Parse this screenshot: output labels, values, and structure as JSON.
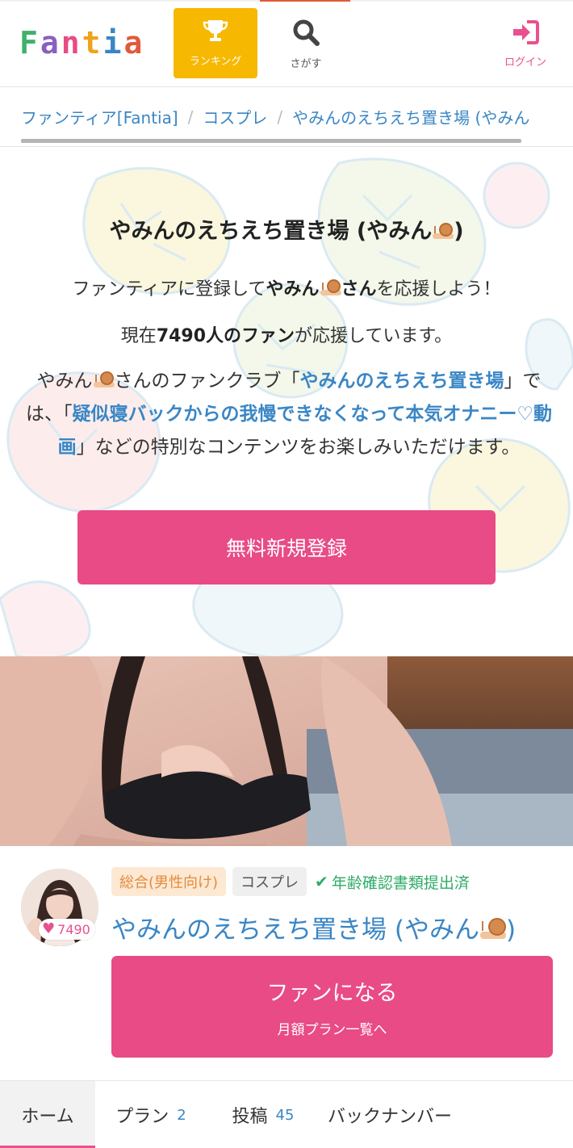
{
  "header": {
    "logo_letters": [
      {
        "char": "F",
        "color": "#3fb16a"
      },
      {
        "char": "a",
        "color": "#8a5fc0"
      },
      {
        "char": "n",
        "color": "#e84b85"
      },
      {
        "char": "t",
        "color": "#f0a21c"
      },
      {
        "char": "i",
        "color": "#3a86c5"
      },
      {
        "char": "a",
        "color": "#e05a3c"
      }
    ],
    "ranking_label": "ランキング",
    "search_label": "さがす",
    "login_label": "ログイン"
  },
  "breadcrumb": {
    "items": [
      "ファンティア[Fantia]",
      "コスプレ",
      "やみんのえちえち置き場 (やみん"
    ],
    "separator": "/"
  },
  "intro": {
    "title_text": "やみんのえちえち置き場 (やみん",
    "title_close": ")",
    "line1_pre": "ファンティアに登録して",
    "line1_name": "やみん",
    "line1_san": "さん",
    "line1_post": "を応援しよう！",
    "line2_pre": "現在",
    "line2_count": "7490人のファン",
    "line2_post": "が応援しています。",
    "desc_pre": "やみん",
    "desc_mid": "さんのファンクラブ「",
    "desc_club": "やみんのえちえち置き場",
    "desc_mid2": "」では、「",
    "desc_post_title": "疑似寝バックからの我慢できなくなって本気オナニー♡動画",
    "desc_tail": "」などの特別なコンテンツをお楽しみいただけます。",
    "register_button": "無料新規登録"
  },
  "profile": {
    "fan_count": "7490",
    "tags": {
      "general": "総合(男性向け)",
      "category": "コスプレ",
      "verified": "年齢確認書類提出済"
    },
    "name": "やみんのえちえち置き場 (やみん",
    "name_close": ")",
    "fan_button_main": "ファンになる",
    "fan_button_sub": "月額プラン一覧へ"
  },
  "tabs": {
    "home": "ホーム",
    "plan": "プラン",
    "plan_count": "2",
    "posts": "投稿",
    "posts_count": "45",
    "back_number": "バックナンバー"
  },
  "colors": {
    "brand_pink": "#e84b85",
    "link_blue": "#3a86c5",
    "ranking_yellow": "#f6b800",
    "verified_green": "#2fab67"
  }
}
